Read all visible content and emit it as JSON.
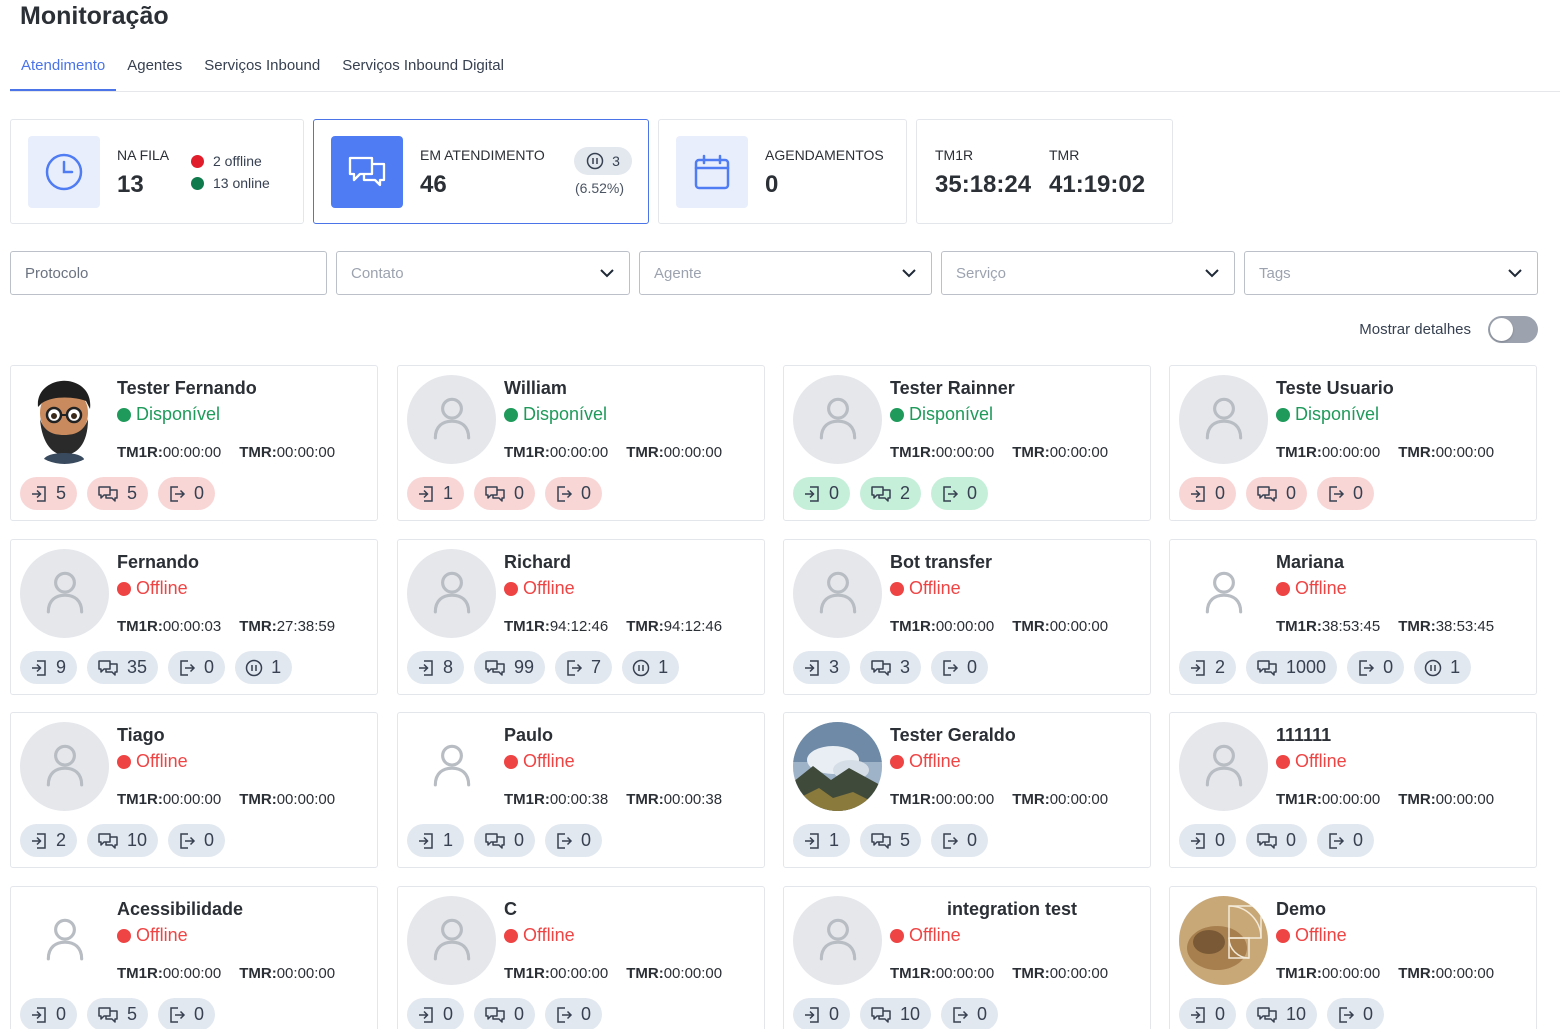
{
  "page": {
    "title": "Monitoração"
  },
  "tabs": [
    {
      "label": "Atendimento",
      "active": true
    },
    {
      "label": "Agentes",
      "active": false
    },
    {
      "label": "Serviços Inbound",
      "active": false
    },
    {
      "label": "Serviços Inbound Digital",
      "active": false
    }
  ],
  "stats": {
    "queue": {
      "label": "NA FILA",
      "value": "13",
      "offline": "2 offline",
      "online": "13 online"
    },
    "in_service": {
      "label": "EM ATENDIMENTO",
      "value": "46",
      "paused": "3",
      "paused_pct": "(6.52%)"
    },
    "schedules": {
      "label": "AGENDAMENTOS",
      "value": "0"
    },
    "times": {
      "tm1r_label": "TM1R",
      "tm1r_value": "35:18:24",
      "tmr_label": "TMR",
      "tmr_value": "41:19:02"
    }
  },
  "filters": {
    "protocol": "Protocolo",
    "contact": "Contato",
    "agent": "Agente",
    "service": "Serviço",
    "tags": "Tags"
  },
  "details_toggle": {
    "label": "Mostrar detalhes",
    "on": false
  },
  "colors": {
    "accent": "#4a74e8",
    "online": "#1f9a5b",
    "offline": "#ef4444",
    "chip_red": "#f9d6d6",
    "chip_green": "#c6efda",
    "chip_gray": "#e2e8f0"
  },
  "agents": [
    {
      "name": "Tester Fernando",
      "status": "Disponível",
      "online": true,
      "avatar": "emoji-man",
      "tm1r": "00:00:00",
      "tmr": "00:00:00",
      "chip_color": "red",
      "chips": {
        "in": "5",
        "chat": "5",
        "out": "0"
      }
    },
    {
      "name": "William",
      "status": "Disponível",
      "online": true,
      "avatar": "default",
      "tm1r": "00:00:00",
      "tmr": "00:00:00",
      "chip_color": "red",
      "chips": {
        "in": "1",
        "chat": "0",
        "out": "0"
      }
    },
    {
      "name": "Tester Rainner",
      "status": "Disponível",
      "online": true,
      "avatar": "default",
      "tm1r": "00:00:00",
      "tmr": "00:00:00",
      "chip_color": "green",
      "chips": {
        "in": "0",
        "chat": "2",
        "out": "0"
      }
    },
    {
      "name": "Teste Usuario",
      "status": "Disponível",
      "online": true,
      "avatar": "default",
      "tm1r": "00:00:00",
      "tmr": "00:00:00",
      "chip_color": "red",
      "chips": {
        "in": "0",
        "chat": "0",
        "out": "0"
      }
    },
    {
      "name": "Fernando",
      "status": "Offline",
      "online": false,
      "avatar": "default",
      "tm1r": "00:00:03",
      "tmr": "27:38:59",
      "chip_color": "gray",
      "chips": {
        "in": "9",
        "chat": "35",
        "out": "0",
        "pause": "1"
      }
    },
    {
      "name": "Richard",
      "status": "Offline",
      "online": false,
      "avatar": "default",
      "tm1r": "94:12:46",
      "tmr": "94:12:46",
      "chip_color": "gray",
      "chips": {
        "in": "8",
        "chat": "99",
        "out": "7",
        "pause": "1"
      }
    },
    {
      "name": "Bot transfer",
      "status": "Offline",
      "online": false,
      "avatar": "default",
      "tm1r": "00:00:00",
      "tmr": "00:00:00",
      "chip_color": "gray",
      "chips": {
        "in": "3",
        "chat": "3",
        "out": "0"
      }
    },
    {
      "name": "Mariana",
      "status": "Offline",
      "online": false,
      "avatar": "plain",
      "tm1r": "38:53:45",
      "tmr": "38:53:45",
      "chip_color": "gray",
      "chips": {
        "in": "2",
        "chat": "1000",
        "out": "0",
        "pause": "1"
      }
    },
    {
      "name": "Tiago",
      "status": "Offline",
      "online": false,
      "avatar": "default",
      "tm1r": "00:00:00",
      "tmr": "00:00:00",
      "chip_color": "gray",
      "chips": {
        "in": "2",
        "chat": "10",
        "out": "0"
      }
    },
    {
      "name": "Paulo",
      "status": "Offline",
      "online": false,
      "avatar": "plain",
      "tm1r": "00:00:38",
      "tmr": "00:00:38",
      "chip_color": "gray",
      "chips": {
        "in": "1",
        "chat": "0",
        "out": "0"
      }
    },
    {
      "name": "Tester Geraldo",
      "status": "Offline",
      "online": false,
      "avatar": "photo-mountain",
      "tm1r": "00:00:00",
      "tmr": "00:00:00",
      "chip_color": "gray",
      "chips": {
        "in": "1",
        "chat": "5",
        "out": "0"
      }
    },
    {
      "name": "111111",
      "status": "Offline",
      "online": false,
      "avatar": "default",
      "tm1r": "00:00:00",
      "tmr": "00:00:00",
      "chip_color": "gray",
      "chips": {
        "in": "0",
        "chat": "0",
        "out": "0"
      }
    },
    {
      "name": "Acessibilidade",
      "status": "Offline",
      "online": false,
      "avatar": "plain",
      "tm1r": "00:00:00",
      "tmr": "00:00:00",
      "chip_color": "gray",
      "chips": {
        "in": "0",
        "chat": "5",
        "out": "0"
      }
    },
    {
      "name": "C",
      "status": "Offline",
      "online": false,
      "avatar": "default",
      "tm1r": "00:00:00",
      "tmr": "00:00:00",
      "chip_color": "gray",
      "chips": {
        "in": "0",
        "chat": "0",
        "out": "0"
      }
    },
    {
      "name": "integration test",
      "status": "Offline",
      "online": false,
      "avatar": "default",
      "tm1r": "00:00:00",
      "tmr": "00:00:00",
      "chip_color": "gray",
      "chips": {
        "in": "0",
        "chat": "10",
        "out": "0"
      }
    },
    {
      "name": "Demo",
      "status": "Offline",
      "online": false,
      "avatar": "photo-spiral",
      "tm1r": "00:00:00",
      "tmr": "00:00:00",
      "chip_color": "gray",
      "chips": {
        "in": "0",
        "chat": "10",
        "out": "0"
      }
    }
  ]
}
